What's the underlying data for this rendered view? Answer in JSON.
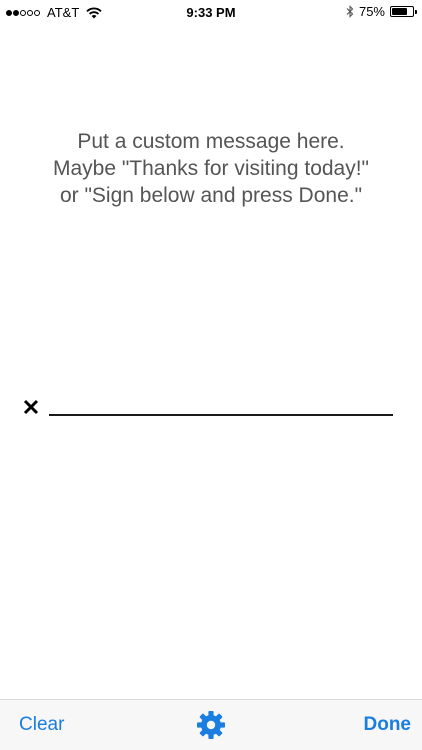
{
  "status_bar": {
    "carrier": "AT&T",
    "time": "9:33 PM",
    "battery_percent": "75%",
    "battery_level": 0.75,
    "signal_bars_filled": 2,
    "signal_bars_total": 5,
    "icons": [
      "signal-dots-icon",
      "wifi-icon",
      "bluetooth-icon",
      "battery-icon"
    ]
  },
  "message": {
    "lines": [
      "Put a custom message here.",
      "Maybe \"Thanks for visiting today!\"",
      "or \"Sign below and press Done.\""
    ]
  },
  "signature": {
    "marker_icon": "x-mark-icon"
  },
  "toolbar": {
    "clear_label": "Clear",
    "done_label": "Done",
    "settings_icon": "gear-icon"
  },
  "colors": {
    "accent": "#1a7de0",
    "message_text": "#555555",
    "toolbar_bg": "#f7f7f7"
  }
}
